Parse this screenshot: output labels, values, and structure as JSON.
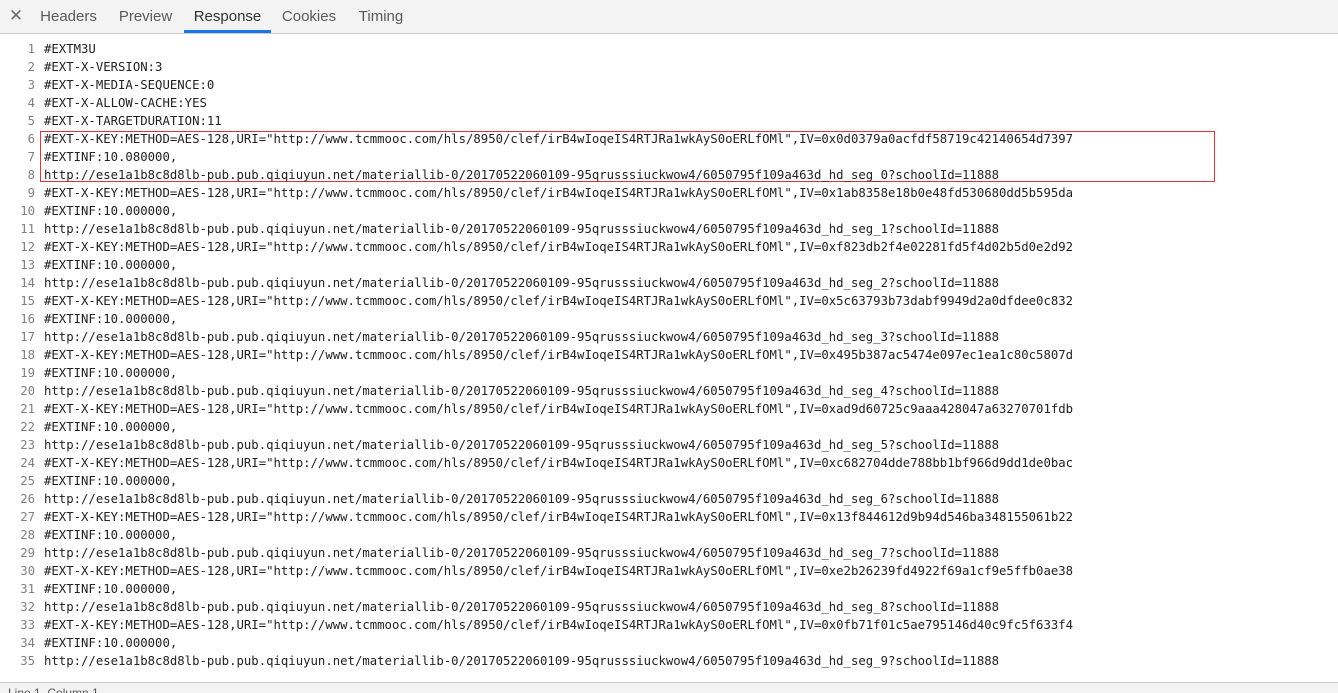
{
  "tabs": {
    "close_icon": "✕",
    "items": [
      {
        "label": "Headers"
      },
      {
        "label": "Preview"
      },
      {
        "label": "Response"
      },
      {
        "label": "Cookies"
      },
      {
        "label": "Timing"
      }
    ],
    "active": "Response",
    "accent_color": "#1a73e8"
  },
  "editor": {
    "highlight_color": "#d9363e",
    "highlight_lines": [
      6,
      8
    ],
    "lines": [
      {
        "num": "1",
        "text": "#EXTM3U"
      },
      {
        "num": "2",
        "text": "#EXT-X-VERSION:3"
      },
      {
        "num": "3",
        "text": "#EXT-X-MEDIA-SEQUENCE:0"
      },
      {
        "num": "4",
        "text": "#EXT-X-ALLOW-CACHE:YES"
      },
      {
        "num": "5",
        "text": "#EXT-X-TARGETDURATION:11"
      },
      {
        "num": "6",
        "text": "#EXT-X-KEY:METHOD=AES-128,URI=\"http://www.tcmmooc.com/hls/8950/clef/irB4wIoqeIS4RTJRa1wkAyS0oERLfOMl\",IV=0x0d0379a0acfdf58719c42140654d7397"
      },
      {
        "num": "7",
        "text": "#EXTINF:10.080000,"
      },
      {
        "num": "8",
        "text": "http://ese1a1b8c8d8lb-pub.pub.qiqiuyun.net/materiallib-0/20170522060109-95qrusssiuckwow4/6050795f109a463d_hd_seg_0?schoolId=11888"
      },
      {
        "num": "9",
        "text": "#EXT-X-KEY:METHOD=AES-128,URI=\"http://www.tcmmooc.com/hls/8950/clef/irB4wIoqeIS4RTJRa1wkAyS0oERLfOMl\",IV=0x1ab8358e18b0e48fd530680dd5b595da"
      },
      {
        "num": "10",
        "text": "#EXTINF:10.000000,"
      },
      {
        "num": "11",
        "text": "http://ese1a1b8c8d8lb-pub.pub.qiqiuyun.net/materiallib-0/20170522060109-95qrusssiuckwow4/6050795f109a463d_hd_seg_1?schoolId=11888"
      },
      {
        "num": "12",
        "text": "#EXT-X-KEY:METHOD=AES-128,URI=\"http://www.tcmmooc.com/hls/8950/clef/irB4wIoqeIS4RTJRa1wkAyS0oERLfOMl\",IV=0xf823db2f4e02281fd5f4d02b5d0e2d92"
      },
      {
        "num": "13",
        "text": "#EXTINF:10.000000,"
      },
      {
        "num": "14",
        "text": "http://ese1a1b8c8d8lb-pub.pub.qiqiuyun.net/materiallib-0/20170522060109-95qrusssiuckwow4/6050795f109a463d_hd_seg_2?schoolId=11888"
      },
      {
        "num": "15",
        "text": "#EXT-X-KEY:METHOD=AES-128,URI=\"http://www.tcmmooc.com/hls/8950/clef/irB4wIoqeIS4RTJRa1wkAyS0oERLfOMl\",IV=0x5c63793b73dabf9949d2a0dfdee0c832"
      },
      {
        "num": "16",
        "text": "#EXTINF:10.000000,"
      },
      {
        "num": "17",
        "text": "http://ese1a1b8c8d8lb-pub.pub.qiqiuyun.net/materiallib-0/20170522060109-95qrusssiuckwow4/6050795f109a463d_hd_seg_3?schoolId=11888"
      },
      {
        "num": "18",
        "text": "#EXT-X-KEY:METHOD=AES-128,URI=\"http://www.tcmmooc.com/hls/8950/clef/irB4wIoqeIS4RTJRa1wkAyS0oERLfOMl\",IV=0x495b387ac5474e097ec1ea1c80c5807d"
      },
      {
        "num": "19",
        "text": "#EXTINF:10.000000,"
      },
      {
        "num": "20",
        "text": "http://ese1a1b8c8d8lb-pub.pub.qiqiuyun.net/materiallib-0/20170522060109-95qrusssiuckwow4/6050795f109a463d_hd_seg_4?schoolId=11888"
      },
      {
        "num": "21",
        "text": "#EXT-X-KEY:METHOD=AES-128,URI=\"http://www.tcmmooc.com/hls/8950/clef/irB4wIoqeIS4RTJRa1wkAyS0oERLfOMl\",IV=0xad9d60725c9aaa428047a63270701fdb"
      },
      {
        "num": "22",
        "text": "#EXTINF:10.000000,"
      },
      {
        "num": "23",
        "text": "http://ese1a1b8c8d8lb-pub.pub.qiqiuyun.net/materiallib-0/20170522060109-95qrusssiuckwow4/6050795f109a463d_hd_seg_5?schoolId=11888"
      },
      {
        "num": "24",
        "text": "#EXT-X-KEY:METHOD=AES-128,URI=\"http://www.tcmmooc.com/hls/8950/clef/irB4wIoqeIS4RTJRa1wkAyS0oERLfOMl\",IV=0xc682704dde788bb1bf966d9dd1de0bac"
      },
      {
        "num": "25",
        "text": "#EXTINF:10.000000,"
      },
      {
        "num": "26",
        "text": "http://ese1a1b8c8d8lb-pub.pub.qiqiuyun.net/materiallib-0/20170522060109-95qrusssiuckwow4/6050795f109a463d_hd_seg_6?schoolId=11888"
      },
      {
        "num": "27",
        "text": "#EXT-X-KEY:METHOD=AES-128,URI=\"http://www.tcmmooc.com/hls/8950/clef/irB4wIoqeIS4RTJRa1wkAyS0oERLfOMl\",IV=0x13f844612d9b94d546ba348155061b22"
      },
      {
        "num": "28",
        "text": "#EXTINF:10.000000,"
      },
      {
        "num": "29",
        "text": "http://ese1a1b8c8d8lb-pub.pub.qiqiuyun.net/materiallib-0/20170522060109-95qrusssiuckwow4/6050795f109a463d_hd_seg_7?schoolId=11888"
      },
      {
        "num": "30",
        "text": "#EXT-X-KEY:METHOD=AES-128,URI=\"http://www.tcmmooc.com/hls/8950/clef/irB4wIoqeIS4RTJRa1wkAyS0oERLfOMl\",IV=0xe2b26239fd4922f69a1cf9e5ffb0ae38"
      },
      {
        "num": "31",
        "text": "#EXTINF:10.000000,"
      },
      {
        "num": "32",
        "text": "http://ese1a1b8c8d8lb-pub.pub.qiqiuyun.net/materiallib-0/20170522060109-95qrusssiuckwow4/6050795f109a463d_hd_seg_8?schoolId=11888"
      },
      {
        "num": "33",
        "text": "#EXT-X-KEY:METHOD=AES-128,URI=\"http://www.tcmmooc.com/hls/8950/clef/irB4wIoqeIS4RTJRa1wkAyS0oERLfOMl\",IV=0x0fb71f01c5ae795146d40c9fc5f633f4"
      },
      {
        "num": "34",
        "text": "#EXTINF:10.000000,"
      },
      {
        "num": "35",
        "text": "http://ese1a1b8c8d8lb-pub.pub.qiqiuyun.net/materiallib-0/20170522060109-95qrusssiuckwow4/6050795f109a463d_hd_seg_9?schoolId=11888"
      }
    ]
  },
  "statusbar": {
    "text": "Line 1, Column 1"
  }
}
